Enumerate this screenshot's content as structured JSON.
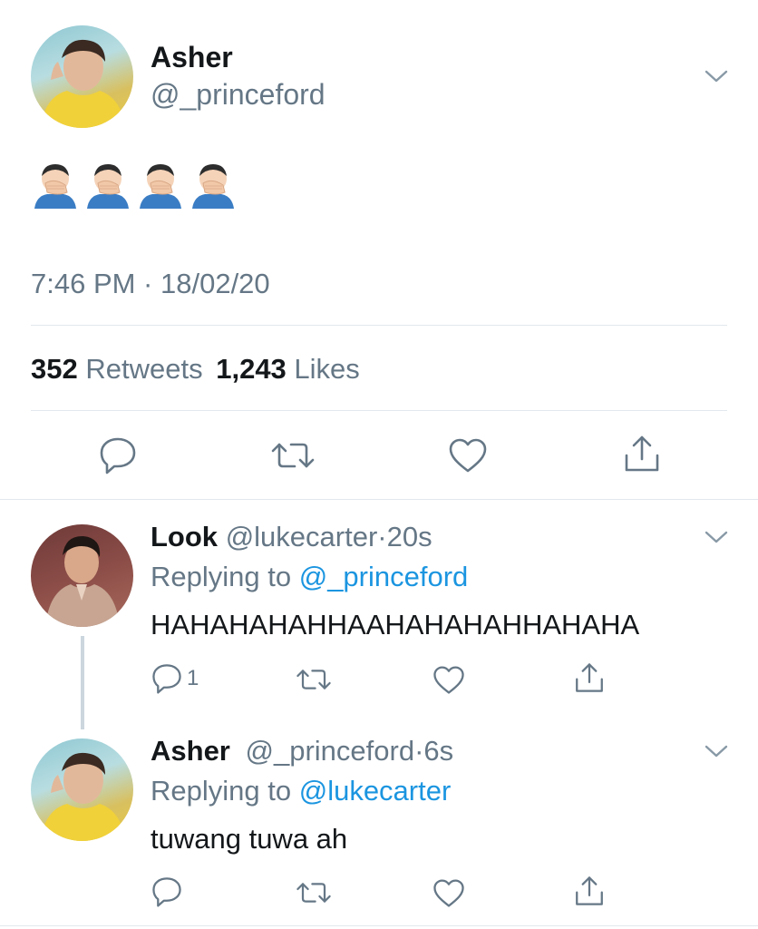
{
  "main_tweet": {
    "name": "Asher",
    "handle": "@_princeford",
    "emoji_text": "🤦🏻‍♂️🤦🏻‍♂️🤦🏻‍♂️🤦🏻‍♂️",
    "timestamp": "7:46 PM · 18/02/20",
    "retweet_count": "352",
    "retweet_label": "Retweets",
    "like_count": "1,243",
    "like_label": "Likes"
  },
  "replies": [
    {
      "name": "Look",
      "handle": "@lukecarter",
      "separator": "·",
      "time": "20s",
      "replying_prefix": "Replying to",
      "replying_to": "@_princeford",
      "text": "HAHAHAHAHHAAHAHAHAHHAHAHA",
      "reply_count": "1"
    },
    {
      "name": "Asher",
      "handle": "@_princeford",
      "separator": "·",
      "time": "6s",
      "replying_prefix": "Replying to",
      "replying_to": "@lukecarter",
      "text": "tuwang tuwa ah"
    }
  ],
  "colors": {
    "text": "#14171a",
    "secondary": "#657786",
    "link": "#1b95e0",
    "divider": "#e1e8ed",
    "thread_line": "#ccd6dd"
  },
  "icons": [
    "chevron-down-icon",
    "reply-icon",
    "retweet-icon",
    "like-icon",
    "share-icon",
    "facepalm-emoji"
  ]
}
